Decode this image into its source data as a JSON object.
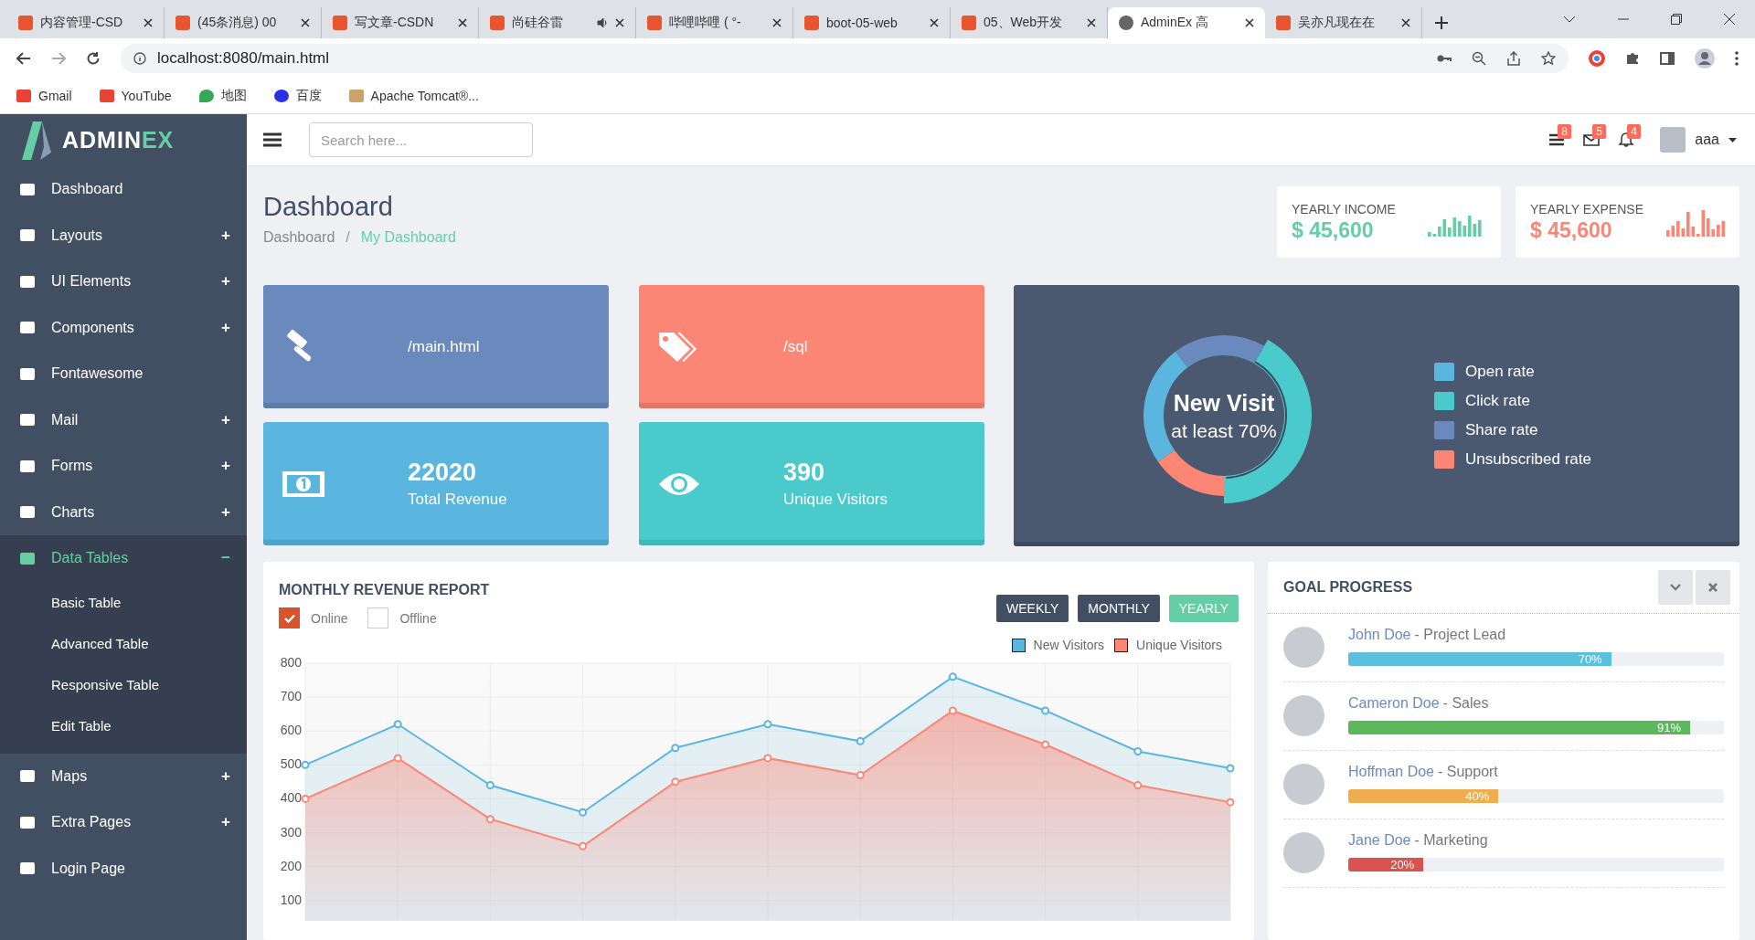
{
  "browser": {
    "tabs": [
      {
        "title": "内容管理-CSD",
        "selected": false,
        "audio": false
      },
      {
        "title": "(45条消息) 00",
        "selected": false,
        "audio": false
      },
      {
        "title": "写文章-CSDN",
        "selected": false,
        "audio": false
      },
      {
        "title": "尚硅谷雷",
        "selected": false,
        "audio": true
      },
      {
        "title": "哔哩哔哩 ( °-",
        "selected": false,
        "audio": false
      },
      {
        "title": "boot-05-web",
        "selected": false,
        "audio": false
      },
      {
        "title": "05、Web开发",
        "selected": false,
        "audio": false
      },
      {
        "title": "AdminEx 高",
        "selected": true,
        "audio": false
      },
      {
        "title": "吴亦凡现在在",
        "selected": false,
        "audio": false
      }
    ],
    "address": "localhost:8080/main.html",
    "bookmarks": [
      "Gmail",
      "YouTube",
      "地图",
      "百度",
      "Apache Tomcat®..."
    ]
  },
  "sidebar": {
    "logo": {
      "part_1": "ADMIN",
      "part_2": "EX"
    },
    "items": [
      {
        "label": "Dashboard",
        "selected": false
      },
      {
        "label": "Layouts",
        "sign": "+",
        "selected": false
      },
      {
        "label": "UI Elements",
        "sign": "+",
        "selected": false
      },
      {
        "label": "Components",
        "sign": "+",
        "selected": false
      },
      {
        "label": "Fontawesome",
        "selected": false
      },
      {
        "label": "Mail",
        "sign": "+",
        "selected": false
      },
      {
        "label": "Forms",
        "sign": "+",
        "selected": false
      },
      {
        "label": "Charts",
        "sign": "+",
        "selected": false
      },
      {
        "label": "Data Tables",
        "sign": "−",
        "expanded": true,
        "selected": true,
        "children": [
          {
            "label": "Basic Table"
          },
          {
            "label": "Advanced Table"
          },
          {
            "label": "Responsive Table"
          },
          {
            "label": "Edit Table"
          }
        ]
      },
      {
        "label": "Maps",
        "sign": "+",
        "selected": false
      },
      {
        "label": "Extra Pages",
        "sign": "+",
        "selected": false
      },
      {
        "label": "Login Page",
        "selected": false
      }
    ]
  },
  "header": {
    "search": {
      "placeholder": "Search here..."
    },
    "badges": [
      "8",
      "5",
      "4"
    ],
    "user": "aaa"
  },
  "page": {
    "title": "Dashboard",
    "breadcrumb_separator": "/",
    "breadcrumb": [
      {
        "label": "Dashboard",
        "selected": false
      },
      {
        "label": "My Dashboard",
        "selected": true
      }
    ],
    "stats": [
      {
        "label": "YEARLY INCOME",
        "value": "$ 45,600",
        "color": "#65cea7"
      },
      {
        "label": "YEARLY EXPENSE",
        "value": "$ 45,600",
        "color": "#fc8675"
      }
    ]
  },
  "tiles": [
    {
      "kind": "link",
      "text": "/main.html",
      "color": "#6a8abe"
    },
    {
      "kind": "link",
      "text": "/sql",
      "color": "#fc8675"
    },
    {
      "kind": "stat",
      "value": "22020",
      "label": "Total Revenue",
      "color": "#5ab6df"
    },
    {
      "kind": "stat",
      "value": "390",
      "label": "Unique Visitors",
      "color": "#4acacb"
    }
  ],
  "visit": {
    "title": "New Visit",
    "subtitle": "at least 70%",
    "legend": [
      {
        "label": "Open rate",
        "color": "#5ab6df"
      },
      {
        "label": "Click rate",
        "color": "#4acacb"
      },
      {
        "label": "Share rate",
        "color": "#6a8abe"
      },
      {
        "label": "Unsubscribed rate",
        "color": "#fc8675"
      }
    ]
  },
  "revenue": {
    "title": "MONTHLY REVENUE REPORT",
    "filters": [
      {
        "label": "Online",
        "checked": true
      },
      {
        "label": "Offline",
        "checked": false
      }
    ],
    "periods": [
      {
        "label": "WEEKLY",
        "selected": false
      },
      {
        "label": "MONTHLY",
        "selected": false
      },
      {
        "label": "YEARLY",
        "selected": true
      }
    ],
    "chart_data": {
      "type": "area",
      "grid": true,
      "ylim": [
        40,
        800
      ],
      "yticks": [
        100,
        200,
        300,
        400,
        500,
        600,
        700,
        800
      ],
      "series": [
        {
          "name": "New Visitors",
          "color": "#5ab6df",
          "values": [
            500,
            620,
            440,
            360,
            550,
            620,
            570,
            760,
            660,
            540,
            490
          ]
        },
        {
          "name": "Unique Visitors",
          "color": "#fc8675",
          "values": [
            400,
            520,
            340,
            260,
            450,
            520,
            470,
            660,
            560,
            440,
            390
          ]
        }
      ]
    }
  },
  "goals": {
    "title": "GOAL PROGRESS",
    "people": [
      {
        "name": "John Doe",
        "role": "- Project Lead",
        "level": 0.7,
        "reading": "70%",
        "color": "#5bc0de"
      },
      {
        "name": "Cameron Doe",
        "role": "- Sales",
        "level": 0.91,
        "reading": "91%",
        "color": "#5cb85c"
      },
      {
        "name": "Hoffman Doe",
        "role": "- Support",
        "level": 0.4,
        "reading": "40%",
        "color": "#f0ad4e"
      },
      {
        "name": "Jane Doe",
        "role": "- Marketing",
        "level": 0.2,
        "reading": "20%",
        "color": "#d9534f"
      }
    ]
  }
}
